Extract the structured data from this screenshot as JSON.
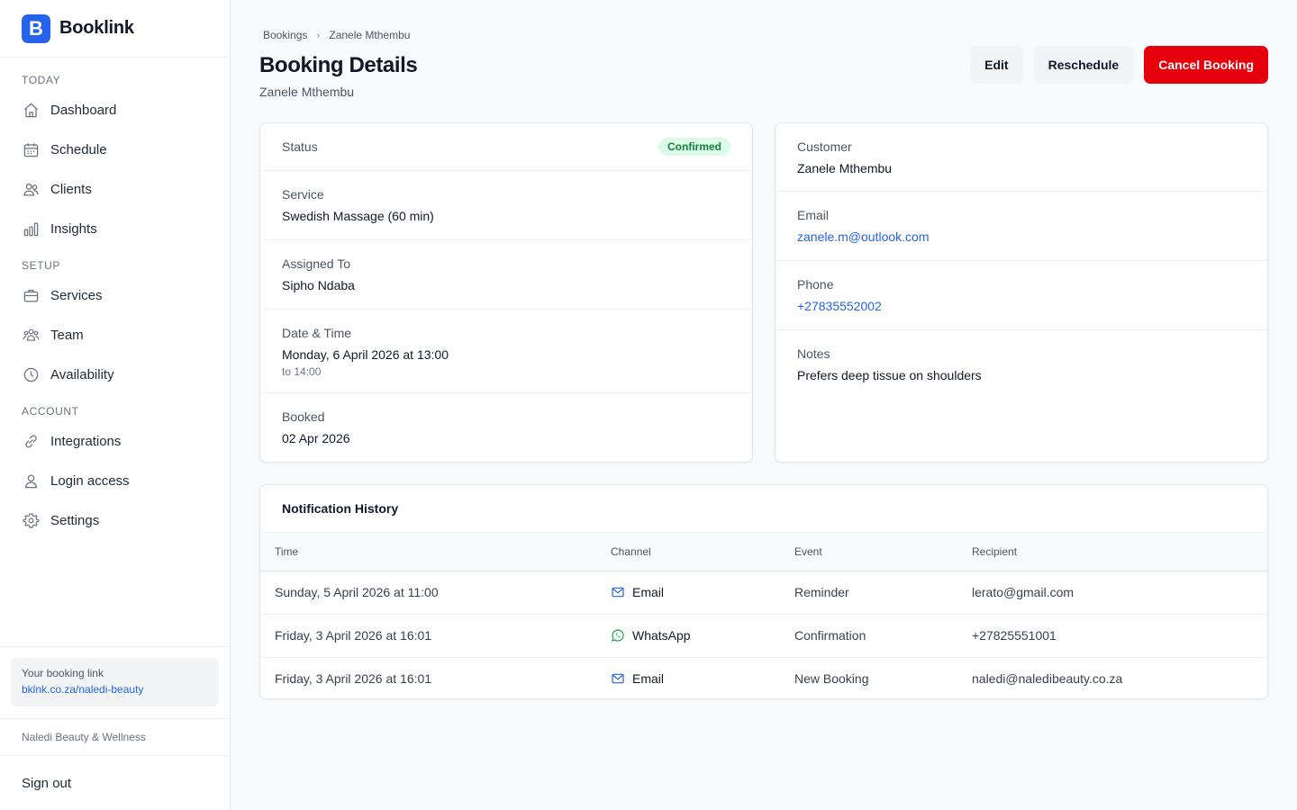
{
  "brand": {
    "logo_letter": "B",
    "name": "Booklink",
    "accent": "#2563eb"
  },
  "sidebar": {
    "sections": [
      {
        "title": "TODAY",
        "items": [
          {
            "label": "Dashboard",
            "icon": "home-icon"
          },
          {
            "label": "Schedule",
            "icon": "calendar-icon"
          },
          {
            "label": "Clients",
            "icon": "users-icon"
          },
          {
            "label": "Insights",
            "icon": "bar-chart-icon"
          }
        ]
      },
      {
        "title": "SETUP",
        "items": [
          {
            "label": "Services",
            "icon": "briefcase-icon"
          },
          {
            "label": "Team",
            "icon": "team-icon"
          },
          {
            "label": "Availability",
            "icon": "clock-icon"
          }
        ]
      },
      {
        "title": "ACCOUNT",
        "items": [
          {
            "label": "Integrations",
            "icon": "link-icon"
          },
          {
            "label": "Login access",
            "icon": "user-icon"
          },
          {
            "label": "Settings",
            "icon": "gear-icon"
          }
        ]
      }
    ],
    "booking_link_label": "Your booking link",
    "booking_link_url": "bklnk.co.za/naledi-beauty",
    "business_name": "Naledi Beauty & Wellness",
    "sign_out": "Sign out"
  },
  "header": {
    "breadcrumb": [
      "Bookings",
      "Zanele Mthembu"
    ],
    "title": "Booking Details",
    "subtitle": "Zanele Mthembu",
    "actions": {
      "edit": "Edit",
      "reschedule": "Reschedule",
      "cancel": "Cancel Booking"
    }
  },
  "booking": {
    "status_label": "Status",
    "status_value": "Confirmed",
    "service_label": "Service",
    "service_value": "Swedish Massage (60 min)",
    "assigned_label": "Assigned To",
    "assigned_value": "Sipho Ndaba",
    "datetime_label": "Date & Time",
    "datetime_value": "Monday, 6 April 2026 at 13:00",
    "datetime_end": "to 14:00",
    "booked_label": "Booked",
    "booked_value": "02 Apr 2026"
  },
  "customer": {
    "name_label": "Customer",
    "name_value": "Zanele Mthembu",
    "email_label": "Email",
    "email_value": "zanele.m@outlook.com",
    "phone_label": "Phone",
    "phone_value": "+27835552002",
    "notes_label": "Notes",
    "notes_value": "Prefers deep tissue on shoulders"
  },
  "notifications": {
    "title": "Notification History",
    "columns": [
      "Time",
      "Channel",
      "Event",
      "Recipient"
    ],
    "rows": [
      {
        "time": "Sunday, 5 April 2026 at 11:00",
        "channel": "Email",
        "channel_icon": "mail-icon",
        "event": "Reminder",
        "recipient": "lerato@gmail.com"
      },
      {
        "time": "Friday, 3 April 2026 at 16:01",
        "channel": "WhatsApp",
        "channel_icon": "whatsapp-icon",
        "event": "Confirmation",
        "recipient": "+27825551001"
      },
      {
        "time": "Friday, 3 April 2026 at 16:01",
        "channel": "Email",
        "channel_icon": "mail-icon",
        "event": "New Booking",
        "recipient": "naledi@naledibeauty.co.za"
      }
    ]
  },
  "colors": {
    "danger": "#e7000b",
    "success_bg": "#dcfce7",
    "success_text": "#15803d",
    "link": "#2563eb"
  }
}
